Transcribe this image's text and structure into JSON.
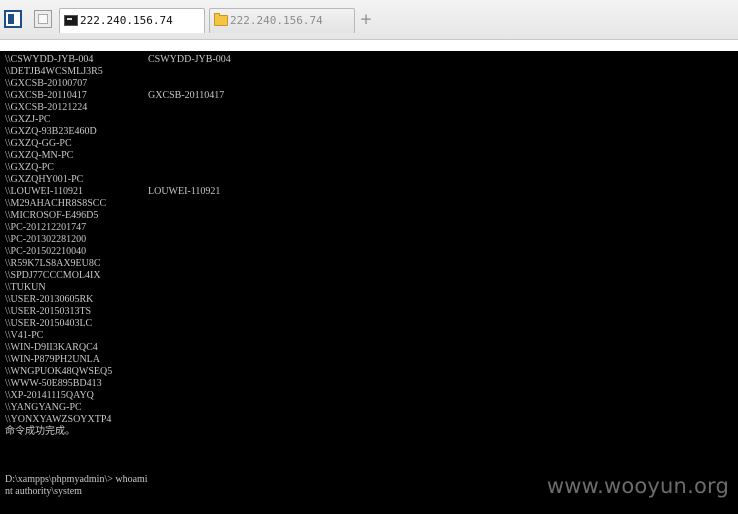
{
  "tabs": [
    {
      "label": "222.240.156.74",
      "icon": "terminal-icon",
      "active": true
    },
    {
      "label": "222.240.156.74",
      "icon": "folder-icon",
      "active": false
    }
  ],
  "add_tab_label": "+",
  "terminal": {
    "lines": [
      {
        "name": "\\\\CSWYDD-JYB-004",
        "comment": "CSWYDD-JYB-004"
      },
      {
        "name": "\\\\DETJB4WCSMLJ3R5",
        "comment": ""
      },
      {
        "name": "\\\\GXCSB-20100707",
        "comment": ""
      },
      {
        "name": "\\\\GXCSB-20110417",
        "comment": "GXCSB-20110417"
      },
      {
        "name": "\\\\GXCSB-20121224",
        "comment": ""
      },
      {
        "name": "\\\\GXZJ-PC",
        "comment": ""
      },
      {
        "name": "\\\\GXZQ-93B23E460D",
        "comment": ""
      },
      {
        "name": "\\\\GXZQ-GG-PC",
        "comment": ""
      },
      {
        "name": "\\\\GXZQ-MN-PC",
        "comment": ""
      },
      {
        "name": "\\\\GXZQ-PC",
        "comment": ""
      },
      {
        "name": "\\\\GXZQHY001-PC",
        "comment": ""
      },
      {
        "name": "\\\\LOUWEI-110921",
        "comment": "LOUWEI-110921"
      },
      {
        "name": "\\\\M29AHACHR8S8SCC",
        "comment": ""
      },
      {
        "name": "\\\\MICROSOF-E496D5",
        "comment": ""
      },
      {
        "name": "\\\\PC-201212201747",
        "comment": ""
      },
      {
        "name": "\\\\PC-201302281200",
        "comment": ""
      },
      {
        "name": "\\\\PC-201502210040",
        "comment": ""
      },
      {
        "name": "\\\\R59K7LS8AX9EU8C",
        "comment": ""
      },
      {
        "name": "\\\\SPDJ77CCCMOL4IX",
        "comment": ""
      },
      {
        "name": "\\\\TUKUN",
        "comment": ""
      },
      {
        "name": "\\\\USER-20130605RK",
        "comment": ""
      },
      {
        "name": "\\\\USER-20150313TS",
        "comment": ""
      },
      {
        "name": "\\\\USER-20150403LC",
        "comment": ""
      },
      {
        "name": "\\\\V41-PC",
        "comment": ""
      },
      {
        "name": "\\\\WIN-D9II3KARQC4",
        "comment": ""
      },
      {
        "name": "\\\\WIN-P879PH2UNLA",
        "comment": ""
      },
      {
        "name": "\\\\WNGPUOK48QWSEQ5",
        "comment": ""
      },
      {
        "name": "\\\\WWW-50E895BD413",
        "comment": ""
      },
      {
        "name": "\\\\XP-20141115QAYQ",
        "comment": ""
      },
      {
        "name": "\\\\YANGYANG-PC",
        "comment": ""
      },
      {
        "name": "\\\\YONXYAWZSOYXTP4",
        "comment": ""
      },
      {
        "name": "命令成功完成。",
        "comment": ""
      },
      {
        "name": "",
        "comment": ""
      },
      {
        "name": "",
        "comment": ""
      },
      {
        "name": "",
        "comment": ""
      },
      {
        "name": "D:\\xampps\\phpmyadmin\\> whoami",
        "comment": ""
      },
      {
        "name": "nt authority\\system",
        "comment": ""
      }
    ]
  },
  "watermark": "www.wooyun.org"
}
